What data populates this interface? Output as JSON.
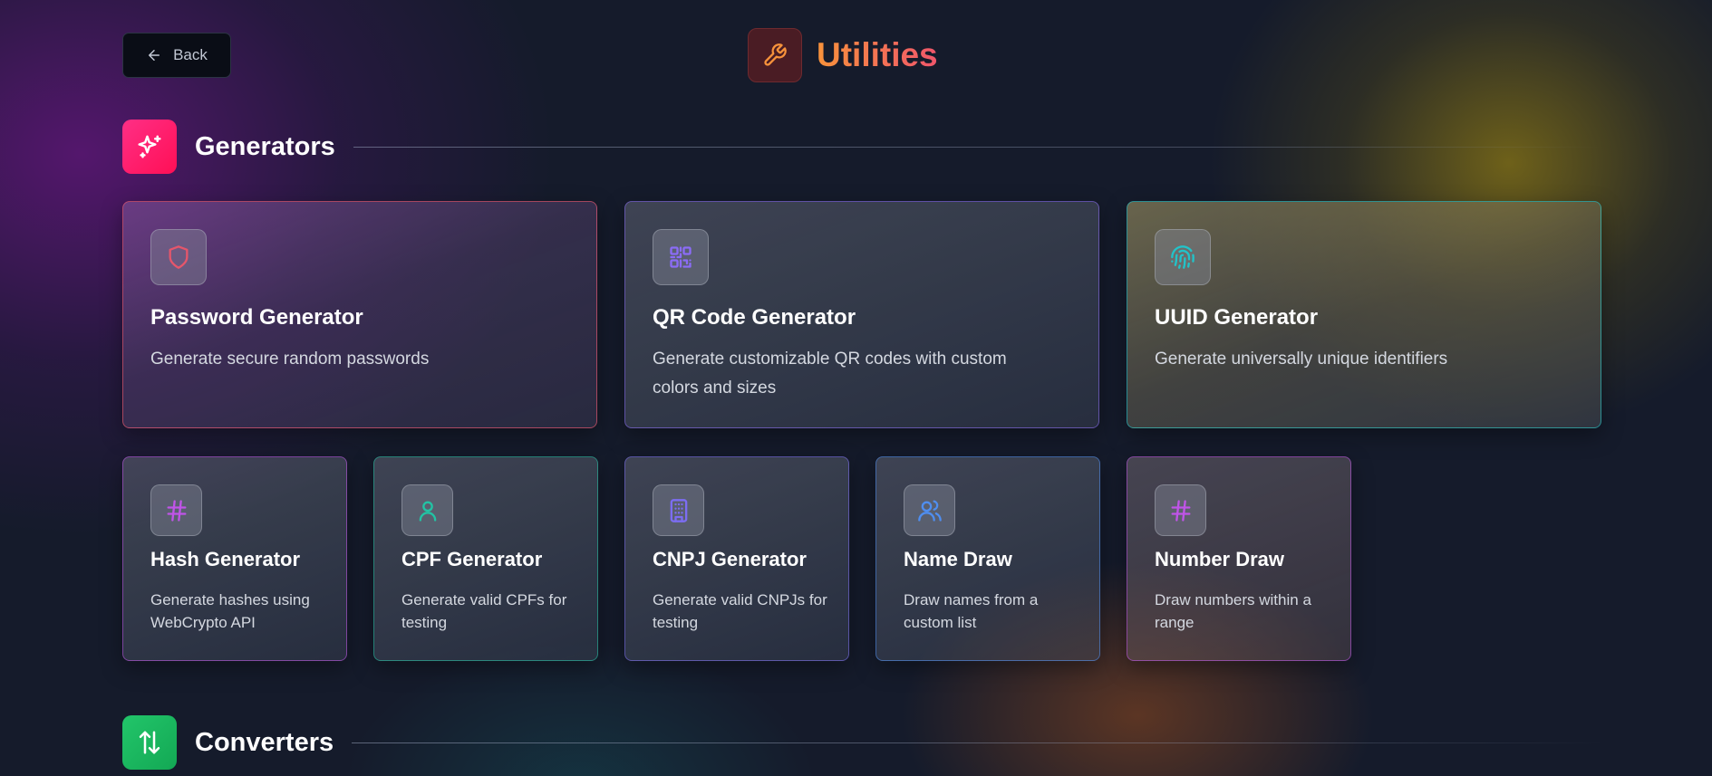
{
  "header": {
    "back_label": "Back",
    "title": "Utilities",
    "title_icon": "wrench-icon"
  },
  "colors": {
    "title_gradient": [
      "#f7923b",
      "#f0566b"
    ],
    "generators_icon_bg": "#ff1f6a",
    "converters_icon_bg": "#1fb95e"
  },
  "sections": {
    "generators": {
      "title": "Generators",
      "icon": "sparkles-icon",
      "cards": [
        {
          "title": "Password Generator",
          "description": "Generate secure random passwords",
          "icon": "shield-icon",
          "accent": "#e5566b"
        },
        {
          "title": "QR Code Generator",
          "description": "Generate customizable QR codes with custom colors and sizes",
          "icon": "qr-code-icon",
          "accent": "#8b6cf6"
        },
        {
          "title": "UUID Generator",
          "description": "Generate universally unique identifiers",
          "icon": "fingerprint-icon",
          "accent": "#22c3c9"
        },
        {
          "title": "Hash Generator",
          "description": "Generate hashes using WebCrypto API",
          "icon": "hash-icon",
          "accent": "#c054e8"
        },
        {
          "title": "CPF Generator",
          "description": "Generate valid CPFs for testing",
          "icon": "user-icon",
          "accent": "#22c3a4"
        },
        {
          "title": "CNPJ Generator",
          "description": "Generate valid CNPJs for testing",
          "icon": "building-icon",
          "accent": "#7c6df2"
        },
        {
          "title": "Name Draw",
          "description": "Draw names from a custom list",
          "icon": "users-icon",
          "accent": "#4f8ef0"
        },
        {
          "title": "Number Draw",
          "description": "Draw numbers within a range",
          "icon": "hash-icon",
          "accent": "#c054e8"
        }
      ]
    },
    "converters": {
      "title": "Converters",
      "icon": "arrows-up-down-icon"
    }
  }
}
